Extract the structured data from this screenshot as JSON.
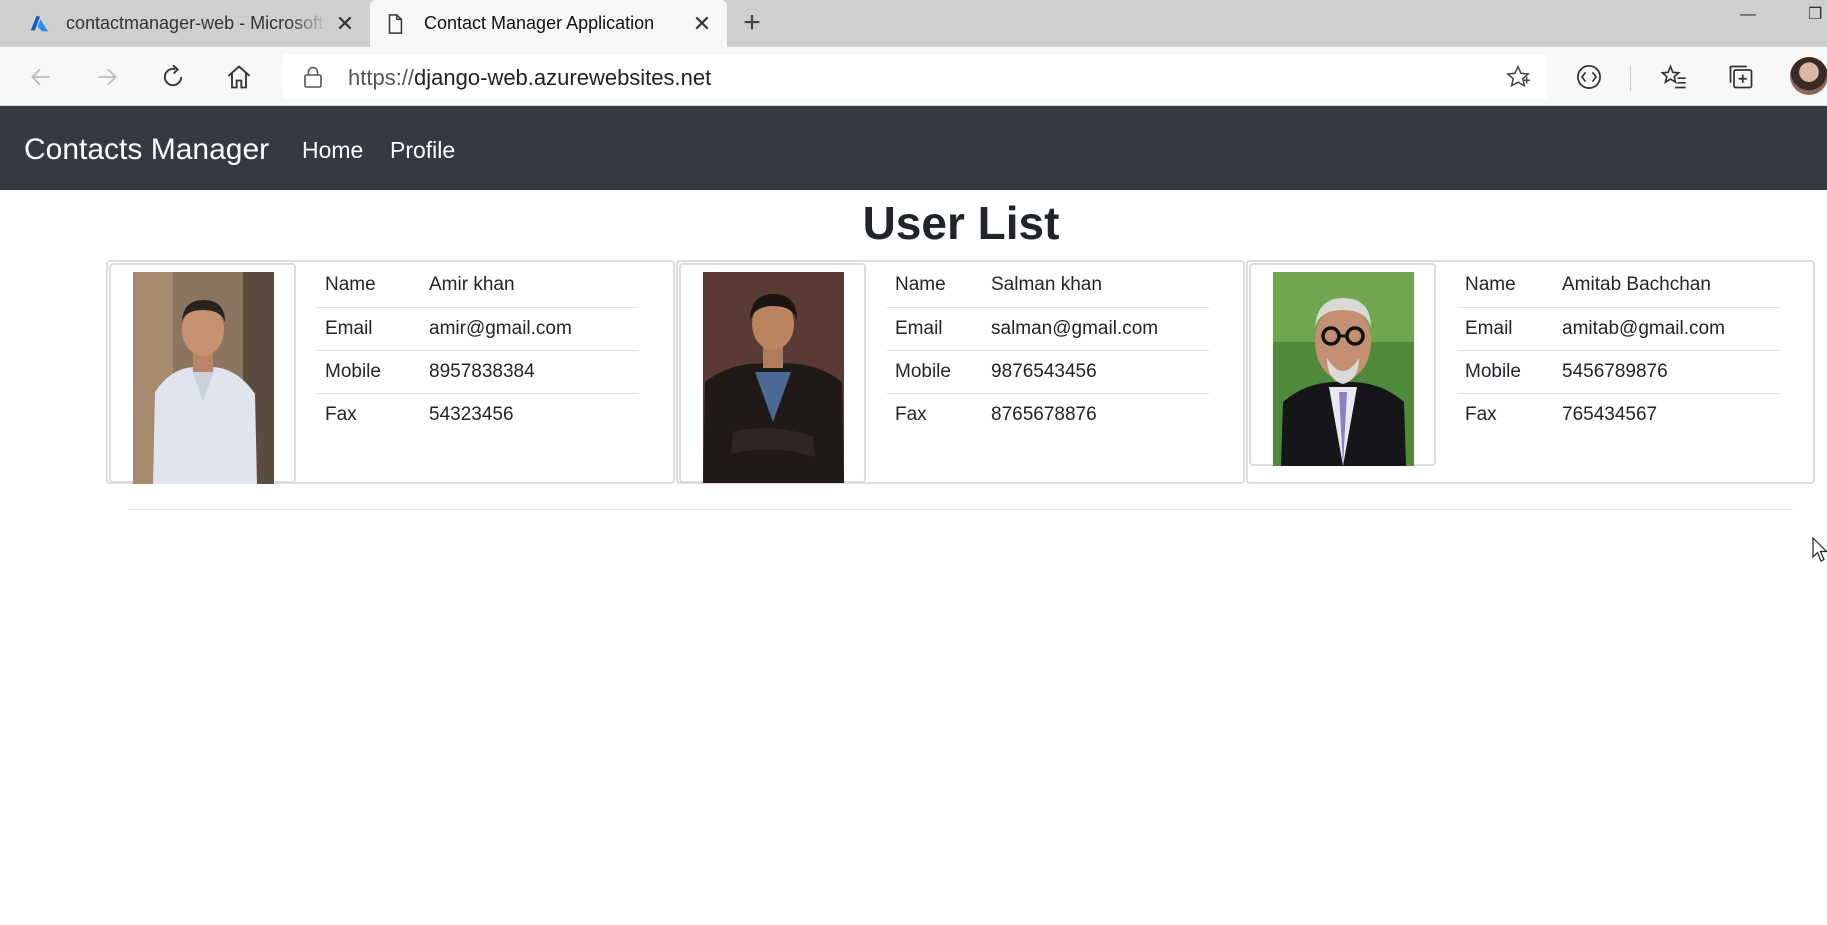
{
  "browser": {
    "tabs": [
      {
        "title": "contactmanager-web - Microsoft Azure",
        "icon": "azure-logo-icon",
        "active": false
      },
      {
        "title": "Contact Manager Application",
        "icon": "page-icon",
        "active": true
      }
    ],
    "url_scheme": "https://",
    "url_host": "django-web.azurewebsites.net"
  },
  "navbar": {
    "brand": "Contacts Manager",
    "links": [
      "Home",
      "Profile"
    ]
  },
  "page": {
    "heading": "User List"
  },
  "labels": {
    "name": "Name",
    "email": "Email",
    "mobile": "Mobile",
    "fax": "Fax"
  },
  "contacts": [
    {
      "name": "Amir khan",
      "email": "amir@gmail.com",
      "mobile": "8957838384",
      "fax": "54323456"
    },
    {
      "name": "Salman khan",
      "email": "salman@gmail.com",
      "mobile": "9876543456",
      "fax": "8765678876"
    },
    {
      "name": "Amitab Bachchan",
      "email": "amitab@gmail.com",
      "mobile": "5456789876",
      "fax": "765434567"
    }
  ],
  "colors": {
    "navbar_bg": "#343a40",
    "azure_blue": "#0078d4"
  }
}
